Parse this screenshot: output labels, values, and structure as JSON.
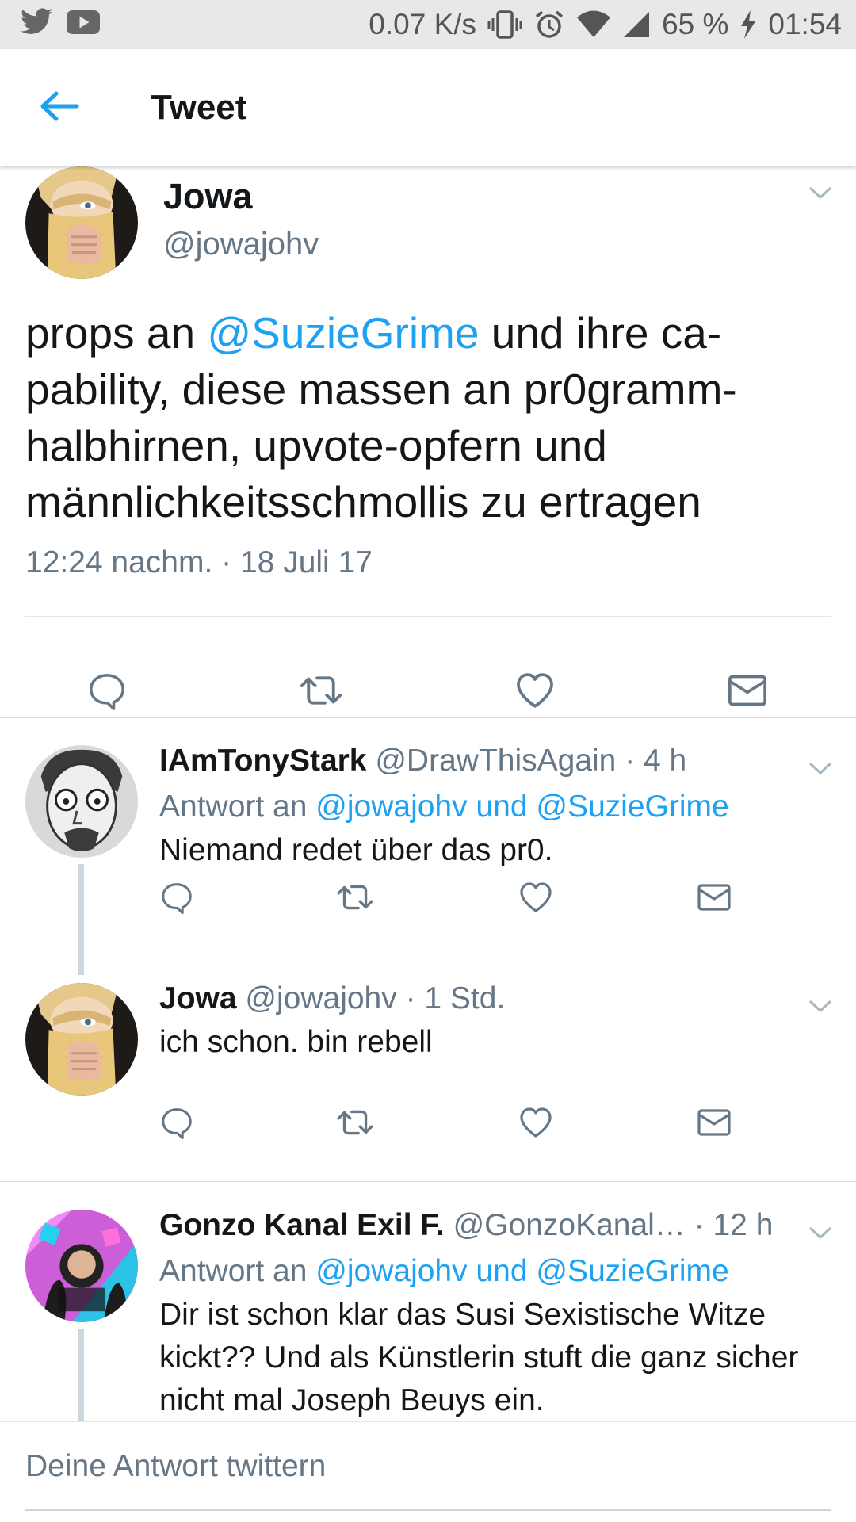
{
  "status_bar": {
    "speed": "0.07 K/s",
    "battery": "65 %",
    "time": "01:54",
    "icons": [
      "twitter-icon",
      "youtube-icon",
      "vibrate-icon",
      "alarm-icon",
      "wifi-icon",
      "signal-icon",
      "charging-icon"
    ]
  },
  "header": {
    "title": "Tweet",
    "back_icon": "arrow-left-icon"
  },
  "main_tweet": {
    "name": "Jowa",
    "handle": "@jowajohv",
    "text_parts": {
      "p1": "props an ",
      "mention": "@SuzieGrime",
      "p2": " und ihre ca-pability, diese massen an pr0gramm-halbhirnen, upvote-opfern und männlichkeitsschmollis zu ertragen"
    },
    "timestamp": "12:24 nachm. · 18 Juli 17",
    "actions": [
      "reply-icon",
      "retweet-icon",
      "like-icon",
      "dm-icon"
    ]
  },
  "replies": [
    {
      "name": "IAmTonyStark",
      "handle_time": "@DrawThisAgain · 4 h",
      "reply_prefix": "Antwort an ",
      "reply_to": "@jowajohv und @SuzieGrime",
      "text": "Niemand redet über das pr0."
    },
    {
      "name": "Jowa",
      "handle_time": "@jowajohv · 1 Std.",
      "text": "ich schon. bin rebell"
    },
    {
      "name": "Gonzo Kanal Exil F.",
      "handle_time": "@GonzoKanal…  · 12 h",
      "reply_prefix": "Antwort an ",
      "reply_to": "@jowajohv und @SuzieGrime",
      "text": "Dir ist schon klar das Susi Sexistische Witze kickt?? Und als Künstlerin stuft die ganz sicher nicht mal Joseph Beuys ein."
    }
  ],
  "compose": {
    "placeholder": "Deine Antwort twittern"
  },
  "colors": {
    "accent": "#1da1f2",
    "secondary_text": "#657786",
    "primary_text": "#14171a"
  }
}
